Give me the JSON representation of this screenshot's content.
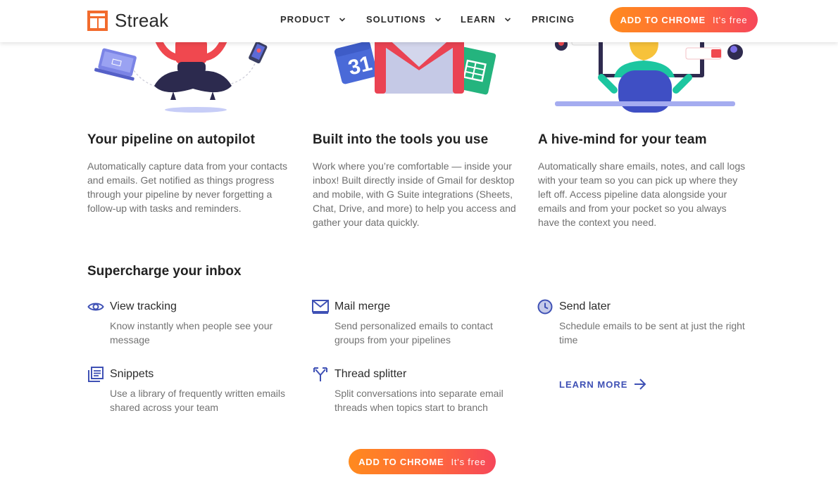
{
  "brand": {
    "name": "Streak"
  },
  "nav": {
    "items": [
      {
        "label": "PRODUCT",
        "has_dropdown": true
      },
      {
        "label": "SOLUTIONS",
        "has_dropdown": true
      },
      {
        "label": "LEARN",
        "has_dropdown": true
      },
      {
        "label": "PRICING",
        "has_dropdown": false
      }
    ],
    "cta": {
      "label": "ADD TO CHROME",
      "sub": "It's free"
    }
  },
  "features": [
    {
      "title": "Your pipeline on autopilot",
      "body": "Automatically capture data from your contacts and emails. Get notified as things progress through your pipeline by never forgetting a follow-up with tasks and reminders."
    },
    {
      "title": "Built into the tools you use",
      "body": "Work where you’re comfortable — inside your inbox!  Built directly inside of Gmail for desktop and mobile, with G Suite integrations (Sheets, Chat, Drive, and more) to help you access and gather your data quickly."
    },
    {
      "title": "A hive-mind for your team",
      "body": "Automatically share emails, notes, and call logs with your team so you can pick up where they left off. Access pipeline data alongside your emails and from your pocket so you always have the context you need."
    }
  ],
  "supercharge": {
    "title": "Supercharge your inbox",
    "items": [
      {
        "icon": "eye-icon",
        "title": "View tracking",
        "desc": "Know instantly when people see your message"
      },
      {
        "icon": "mail-icon",
        "title": "Mail merge",
        "desc": "Send personalized emails to contact groups from your pipelines"
      },
      {
        "icon": "clock-icon",
        "title": "Send later",
        "desc": "Schedule emails to be sent at just the right time"
      },
      {
        "icon": "snippets-icon",
        "title": "Snippets",
        "desc": "Use a library of frequently written emails shared across your team"
      },
      {
        "icon": "split-icon",
        "title": "Thread splitter",
        "desc": "Split conversations into separate email threads when topics start to branch"
      }
    ],
    "learn_more": "LEARN MORE"
  },
  "footer_cta": {
    "label": "ADD TO CHROME",
    "sub": "It's free"
  },
  "illustration": {
    "calendar_day": "31"
  },
  "colors": {
    "accent": "#3f51b5",
    "cta_start": "#ff8a1e",
    "cta_end": "#f6475a",
    "brand_orange": "#f26b2d"
  }
}
